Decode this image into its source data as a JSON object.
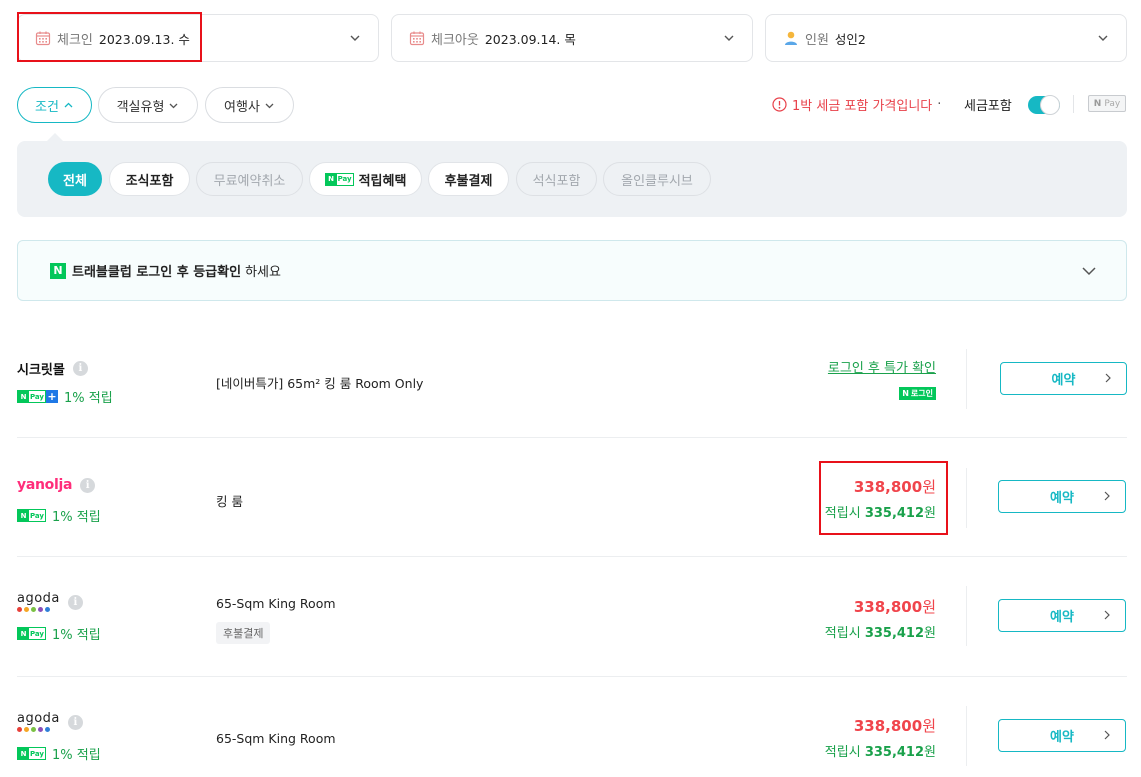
{
  "search": {
    "checkin": {
      "label": "체크인",
      "value": "2023.09.13. 수"
    },
    "checkout": {
      "label": "체크아웃",
      "value": "2023.09.14. 목"
    },
    "guests": {
      "label": "인원",
      "value": "성인2"
    }
  },
  "filters": {
    "condition": "조건",
    "room_type": "객실유형",
    "agency": "여행사",
    "tax_note": "1박 세금 포함 가격입니다",
    "tax_toggle_label": "세금포함",
    "tax_toggle_on": true,
    "npay_label": "Pay"
  },
  "chips": {
    "all": "전체",
    "breakfast": "조식포함",
    "free_cancel": "무료예약취소",
    "reward": "적립혜택",
    "pay_later": "후불결제",
    "dinner": "석식포함",
    "all_inclusive": "올인클루시브"
  },
  "banner": {
    "bold": "트래블클럽 로그인 후 등급확인",
    "rest": "하세요"
  },
  "offers": [
    {
      "seller": "시크릿몰",
      "reward": "1% 적립",
      "room": "[네이버특가] 65m² 킹 룸 Room Only",
      "login_link": "로그인 후 특가 확인",
      "login_badge": "로그인",
      "book": "예약"
    },
    {
      "seller": "yanolja",
      "reward": "1% 적립",
      "room": "킹 룸",
      "price": "338,800",
      "won": "원",
      "earn_label": "적립시",
      "earn_price": "335,412",
      "book": "예약"
    },
    {
      "seller": "agoda",
      "reward": "1% 적립",
      "room": "65-Sqm King Room",
      "tag": "후불결제",
      "price": "338,800",
      "won": "원",
      "earn_label": "적립시",
      "earn_price": "335,412",
      "book": "예약"
    },
    {
      "seller": "agoda",
      "reward": "1% 적립",
      "room": "65-Sqm King Room",
      "price": "338,800",
      "won": "원",
      "earn_label": "적립시",
      "earn_price": "335,412",
      "book": "예약"
    }
  ],
  "colors": {
    "accent": "#16b8c4",
    "price_red": "#f0444b",
    "reward_green": "#1aa14b",
    "naver_green": "#03c75a",
    "highlight_box": "#e8111a"
  }
}
